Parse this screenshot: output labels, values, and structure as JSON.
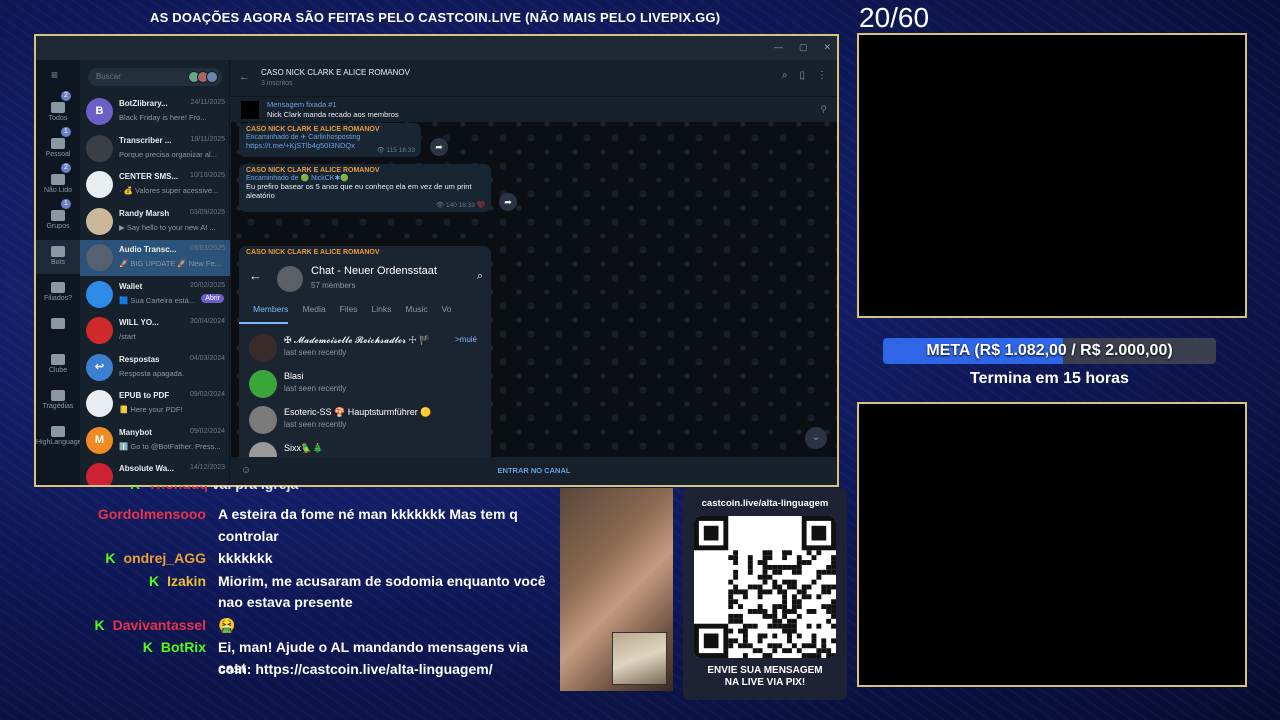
{
  "banner": "AS DOAÇÕES AGORA SÃO FEITAS PELO CASTCOIN.LIVE (NÃO MAIS PELO LIVEPIX.GG)",
  "counter": "20/60",
  "goal": {
    "label": "META (R$ 1.082,00 / R$ 2.000,00)",
    "progress": 0.541,
    "sub": "Termina em 15 horas",
    "fill_color": "#2f66e8"
  },
  "telegram": {
    "search_placeholder": "Buscar",
    "rail": [
      {
        "label": "Todos",
        "badge": "2"
      },
      {
        "label": "Pessoal",
        "badge": "1"
      },
      {
        "label": "Não Lido",
        "badge": "2"
      },
      {
        "label": "Grupos",
        "badge": "1"
      },
      {
        "label": "Bots",
        "badge": ""
      },
      {
        "label": "Filiados?",
        "badge": ""
      },
      {
        "label": "",
        "badge": ""
      },
      {
        "label": "Clube",
        "badge": ""
      },
      {
        "label": "Tragédias",
        "badge": ""
      },
      {
        "label": "HighLanguage",
        "badge": ""
      }
    ],
    "chats": [
      {
        "name": "BotZlibrary...",
        "date": "24/11/2025",
        "preview": "Black Friday is here! Fro...",
        "color": "#6c5fc7",
        "initial": "B"
      },
      {
        "name": "Transcriber ...",
        "date": "19/11/2025",
        "preview": "Porque precisa organizar al...",
        "color": "#3a3f46",
        "initial": ""
      },
      {
        "name": "CENTER SMS...",
        "date": "10/10/2025",
        "preview": "· 💰 Valores super acessive...",
        "color": "#e8edf2",
        "initial": ""
      },
      {
        "name": "Randy Marsh",
        "date": "03/09/2025",
        "preview": "▶ Say hello to your new AI ...",
        "color": "#c9b89a",
        "initial": ""
      },
      {
        "name": "Audio Transc...",
        "date": "03/03/2025",
        "preview": "🚀 BIG UPDATE 🚀 New Fe...",
        "color": "#556070",
        "initial": ""
      },
      {
        "name": "Wallet",
        "date": "20/02/2025",
        "preview": "🟦 Sua Carteira está...",
        "color": "#2f8ae8",
        "initial": "",
        "badge": "Abrir"
      },
      {
        "name": "WILL YO...",
        "date": "30/04/2024",
        "preview": "/start",
        "color": "#d02a2a",
        "initial": ""
      },
      {
        "name": "Respostas",
        "date": "04/03/2024",
        "preview": "Resposta apagada.",
        "color": "#3b7fd0",
        "initial": "↩"
      },
      {
        "name": "EPUB to PDF",
        "date": "09/02/2024",
        "preview": "📒 Here your PDF!",
        "color": "#e8edf2",
        "initial": ""
      },
      {
        "name": "Manybot",
        "date": "09/02/2024",
        "preview": "ℹ️ Go to @BotFather. Press...",
        "color": "#f08a24",
        "initial": "M"
      },
      {
        "name": "Absolute Wa...",
        "date": "14/12/2023",
        "preview": "",
        "color": "#c23",
        "initial": ""
      }
    ],
    "channel": {
      "title": "CASO NICK CLARK E ALICE ROMANOV",
      "subscribers": "3 inscritos"
    },
    "pinned": {
      "title": "Mensagem fixada #1",
      "text": "Nick Clark manda recado aos membros"
    },
    "messages": [
      {
        "header": "CASO NICK CLARK E ALICE ROMANOV",
        "forward": "Encaminhado de ✈ Carlinhosposting",
        "body": "https://t.me/+KjSTlb4g50I3NDQx",
        "views": "115",
        "time": "18:33"
      },
      {
        "header": "CASO NICK CLARK E ALICE ROMANOV",
        "forward": "Encaminhado de 🟢 NickCK✱🟢",
        "body1": "Eu prefiro basear os 5 anos que eu conheço ela em vez de um print",
        "body2": "aleatório",
        "views": "140",
        "time": "18:33"
      }
    ],
    "embed": {
      "header": "CASO NICK CLARK E ALICE ROMANOV",
      "title": "Chat - Neuer Ordensstaat",
      "members": "57 members",
      "tabs": [
        "Members",
        "Media",
        "Files",
        "Links",
        "Music",
        "Vo"
      ],
      "list": [
        {
          "name": "✠ 𝓜𝓪𝓭𝓮𝓶𝓸𝓲𝓼𝓮𝓵𝓵𝓮 𝓡𝓮𝓲𝓬𝓱𝓼𝓪𝓭𝓵𝓮𝓻 ☩ 🏴",
          "status": "last seen recently",
          "role": ">muié",
          "color": "#3a2a2a"
        },
        {
          "name": "Blasi",
          "status": "last seen recently",
          "role": "",
          "color": "#3aa63a"
        },
        {
          "name": "Esoteric-SS 🍄 Hauptsturmführer 🟡",
          "status": "last seen recently",
          "role": "",
          "color": "#7a7a7a"
        },
        {
          "name": "Sixx🦜🎄",
          "status": "last seen recently",
          "role": "",
          "color": "#9a9a9a"
        }
      ]
    },
    "join": "ENTRAR NO CANAL"
  },
  "chat": [
    {
      "user": "Gordolmensooo",
      "color": "#e8344a",
      "lines": [
        "A esteira da fome né man kkkkkkk Mas tem q",
        "controlar"
      ]
    },
    {
      "user": "ondrej_AGG",
      "color": "#e8a03a",
      "lines": [
        "kkkkkkk"
      ]
    },
    {
      "user": "Izakin",
      "color": "#e8c03a",
      "lines": [
        "Miorim, me acusaram de sodomia enquanto você",
        "nao estava presente"
      ]
    },
    {
      "user": "Davivantassel",
      "color": "#e8344a",
      "lines": [
        "🤮"
      ]
    },
    {
      "user": "BotRix",
      "color": "#53fc18",
      "lines": [
        "Ei, man! Ajude o AL mandando mensagens via cast",
        "coin: https://castcoin.live/alta-linguagem/"
      ]
    }
  ],
  "qr": {
    "title": "castcoin.live/alta-linguagem",
    "caption1": "ENVIE SUA MENSAGEM",
    "caption2": "NA LIVE VIA PIX!"
  }
}
